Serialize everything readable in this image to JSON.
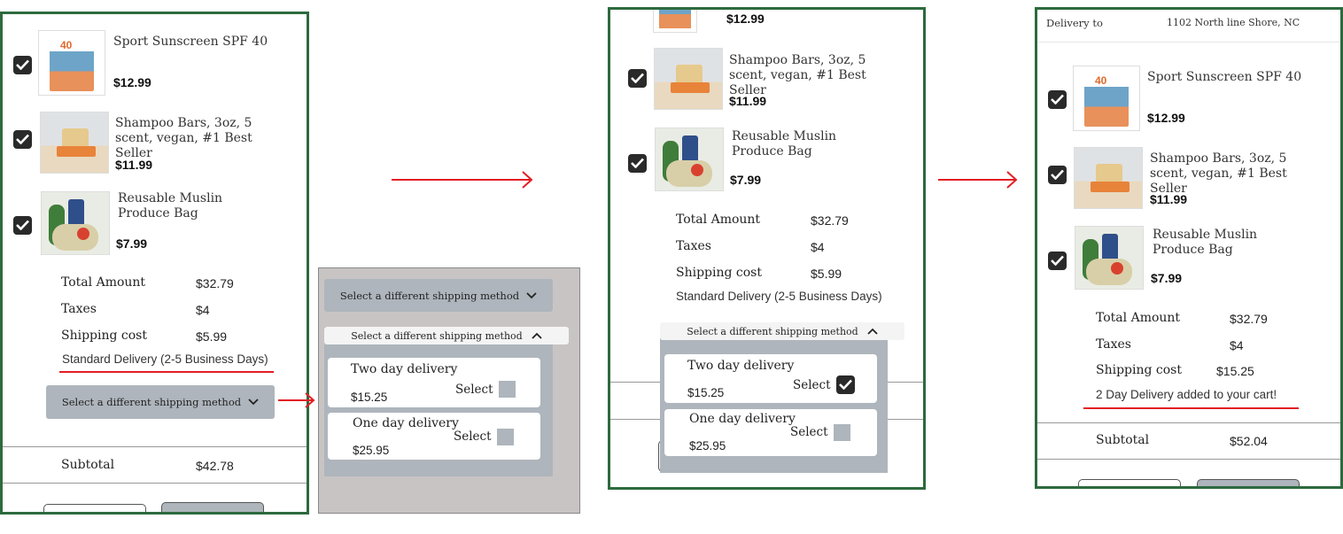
{
  "products": [
    {
      "name": "Sport Sunscreen SPF 40",
      "price": "$12.99",
      "image": "sunscreen-image"
    },
    {
      "name": "Shampoo Bars, 3oz, 5 scent, vegan, #1 Best Seller",
      "price": "$11.99",
      "image": "shampoo-bar-image"
    },
    {
      "name": "Reusable Muslin Produce Bag",
      "price": "$7.99",
      "image": "produce-bag-image"
    }
  ],
  "summary": {
    "total_label": "Total Amount",
    "total_value": "$32.79",
    "taxes_label": "Taxes",
    "taxes_value": "$4",
    "shipping_label": "Shipping cost",
    "shipping_value_standard": "$5.99",
    "shipping_value_two_day": "$15.25",
    "standard_note": "Standard Delivery (2-5 Business Days)",
    "two_day_note": "2 Day Delivery added to your cart!",
    "subtotal_label": "Subtotal",
    "subtotal_value_standard": "$42.78",
    "subtotal_value_two_day": "$52.04"
  },
  "shipping_selector": {
    "toggle_label": "Select a different shipping method",
    "options": [
      {
        "name": "Two day delivery",
        "price": "$15.25",
        "select_label": "Select"
      },
      {
        "name": "One day delivery",
        "price": "$25.95",
        "select_label": "Select"
      }
    ]
  },
  "delivery": {
    "label": "Delivery to",
    "address": "1102 North line Shore, NC"
  },
  "colors": {
    "panel_border": "#2d6a3e",
    "accent_red": "#e31e24",
    "gray_button": "#aeb5bc"
  }
}
